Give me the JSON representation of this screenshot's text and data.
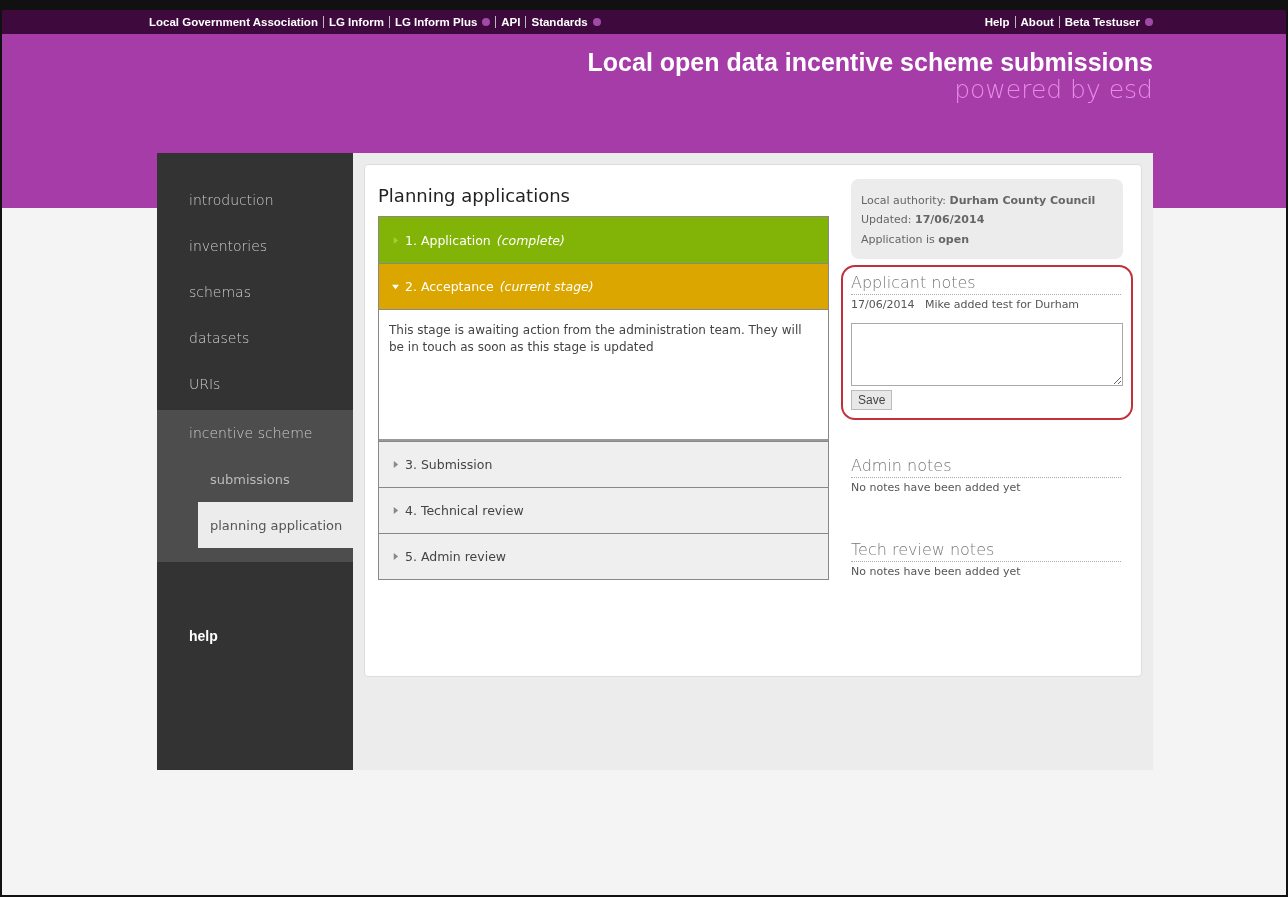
{
  "top_bar": {
    "left_links": [
      {
        "label": "Local Government Association",
        "dropdown": false
      },
      {
        "label": "LG Inform",
        "dropdown": false
      },
      {
        "label": "LG Inform Plus",
        "dropdown": true
      },
      {
        "label": "API",
        "dropdown": false
      },
      {
        "label": "Standards",
        "dropdown": true
      }
    ],
    "right_links": [
      {
        "label": "Help",
        "dropdown": false
      },
      {
        "label": "About",
        "dropdown": false
      },
      {
        "label": "Beta Testuser",
        "dropdown": true
      }
    ]
  },
  "header": {
    "title": "Local open data incentive scheme submissions",
    "subtitle": "powered by esd"
  },
  "sidebar": {
    "items": [
      {
        "label": "introduction",
        "selected": false
      },
      {
        "label": "inventories",
        "selected": false
      },
      {
        "label": "schemas",
        "selected": false
      },
      {
        "label": "datasets",
        "selected": false
      },
      {
        "label": "URIs",
        "selected": false
      },
      {
        "label": "incentive scheme",
        "selected": false,
        "children": [
          {
            "label": "submissions",
            "selected": false
          },
          {
            "label": "planning application",
            "selected": true
          }
        ]
      }
    ],
    "help": "help"
  },
  "main": {
    "title": "Planning applications",
    "stages": [
      {
        "label": "1. Application",
        "status": "(complete)",
        "kind": "complete",
        "expanded": false
      },
      {
        "label": "2. Acceptance",
        "status": "(current stage)",
        "kind": "current",
        "expanded": true,
        "body": "This stage is awaiting action from the administration team. They will be in touch as soon as this stage is updated"
      },
      {
        "label": "3. Submission",
        "kind": "pending",
        "expanded": false
      },
      {
        "label": "4. Technical review",
        "kind": "pending",
        "expanded": false
      },
      {
        "label": "5. Admin review",
        "kind": "pending",
        "expanded": false
      }
    ]
  },
  "info": {
    "lines": [
      "Local authority: **Durham County Council**",
      "Updated: **17/06/2014**",
      "Application is **open**"
    ]
  },
  "notes": [
    {
      "title": "Applicant notes",
      "highlighted": true,
      "entries": [
        {
          "date": "17/06/2014",
          "text": "Mike added test for Durham"
        }
      ],
      "save_label": "Save"
    },
    {
      "title": "Admin notes",
      "highlighted": false,
      "empty_text": "No notes have been added yet"
    },
    {
      "title": "Tech review notes",
      "highlighted": false,
      "empty_text": "No notes have been added yet"
    }
  ]
}
